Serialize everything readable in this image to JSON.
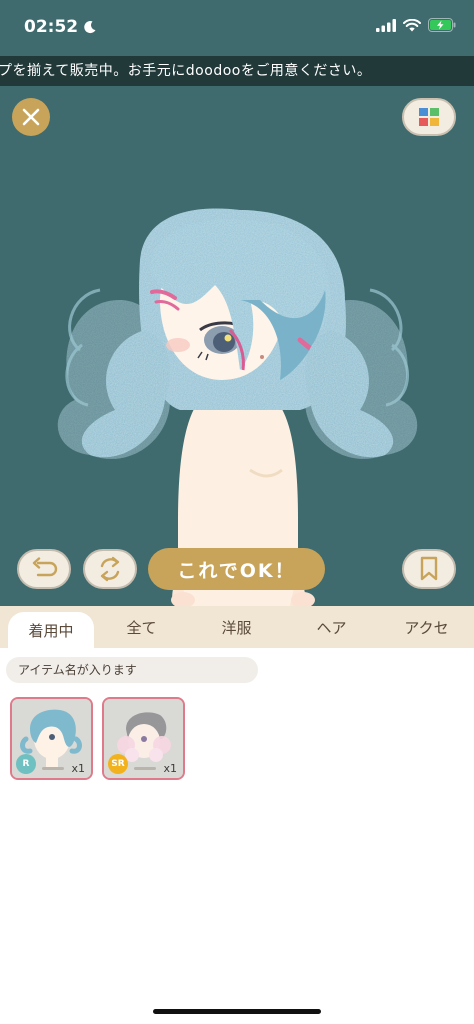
{
  "status_bar": {
    "time": "02:52",
    "icons": [
      "moon-icon",
      "signal-icon",
      "wifi-icon",
      "battery-charging-icon"
    ]
  },
  "ticker": {
    "text": "プを揃えて販売中。お手元にdoodooをご用意ください。"
  },
  "stage": {
    "close_icon": "close-icon",
    "palette_icon": "palette-grid-icon",
    "undo_icon": "undo-icon",
    "randomize_icon": "refresh-icon",
    "confirm_label": "これでOK！",
    "bookmark_icon": "bookmark-icon",
    "background_color": "#3f6b6e"
  },
  "tabs": [
    {
      "label": "着用中",
      "active": true
    },
    {
      "label": "全て",
      "active": false
    },
    {
      "label": "洋服",
      "active": false
    },
    {
      "label": "ヘア",
      "active": false
    },
    {
      "label": "アクセ",
      "active": false
    }
  ],
  "search": {
    "placeholder": "アイテム名が入ります"
  },
  "items": [
    {
      "rarity": "R",
      "rarity_color": "#6fc0c0",
      "quantity": "x1",
      "thumbnail": "blue-wavy-hair"
    },
    {
      "rarity": "SR",
      "rarity_color": "#f2b21e",
      "quantity": "x1",
      "thumbnail": "pink-white-hair"
    }
  ]
}
